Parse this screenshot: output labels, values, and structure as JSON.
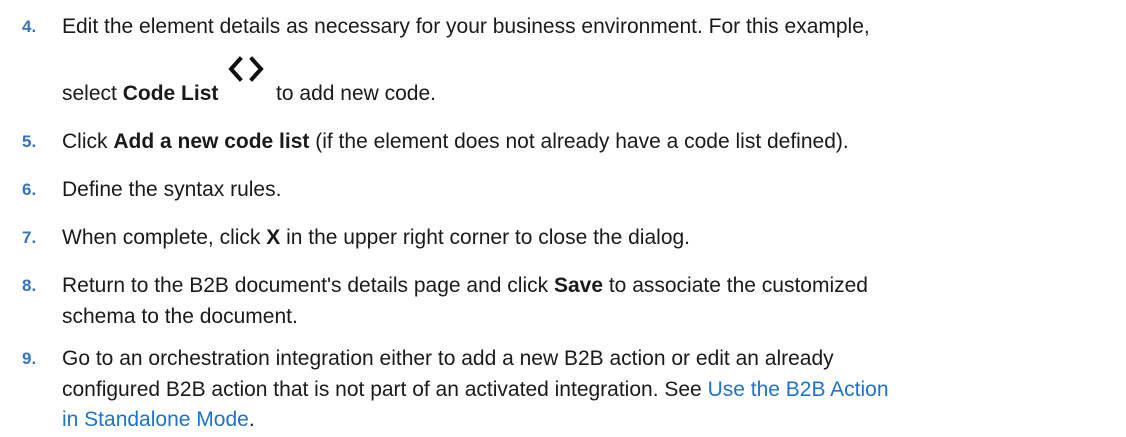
{
  "steps": [
    {
      "number": "4.",
      "line1": "Edit the element details as necessary for your business environment. For this example,",
      "line2_prefix": "select ",
      "line2_bold": "Code List",
      "icon": "code-brackets-icon",
      "line2_suffix": " to add new code."
    },
    {
      "number": "5.",
      "prefix": "Click ",
      "bold": "Add a new code list",
      "suffix": " (if the element does not already have a code list defined)."
    },
    {
      "number": "6.",
      "text": "Define the syntax rules."
    },
    {
      "number": "7.",
      "prefix": "When complete, click ",
      "bold": "X",
      "suffix": " in the upper right corner to close the dialog."
    },
    {
      "number": "8.",
      "line1_prefix": "Return to the B2B document's details page and click ",
      "line1_bold": "Save",
      "line1_suffix": " to associate the customized",
      "line2": "schema to the document."
    },
    {
      "number": "9.",
      "line1": "Go to an orchestration integration either to add a new B2B action or edit an already",
      "line2_prefix": "configured B2B action that is not part of an activated integration. See ",
      "link_part1": "Use the B2B Action",
      "link_part2": "in Standalone Mode",
      "line3_suffix": "."
    }
  ]
}
